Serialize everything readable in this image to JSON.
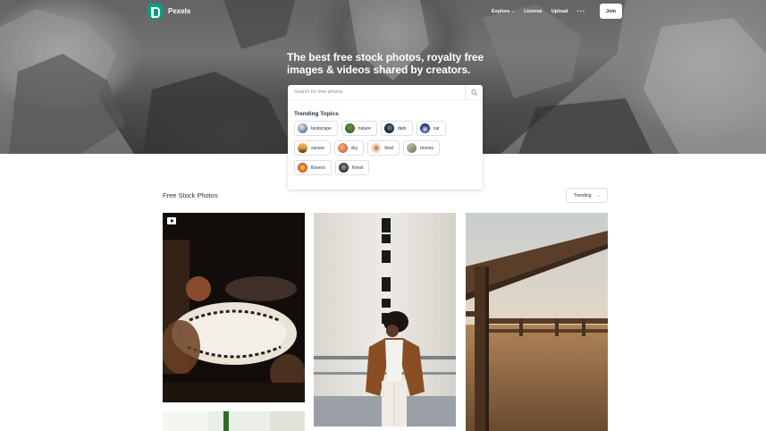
{
  "nav": {
    "logo_text": "Pexels",
    "links": [
      {
        "label": "Explore",
        "has_dropdown": true
      },
      {
        "label": "License"
      },
      {
        "label": "Upload"
      }
    ],
    "more_label": "···",
    "join_label": "Join"
  },
  "hero": {
    "headline_line1": "The best free stock photos, royalty free",
    "headline_line2": "images & videos shared by creators."
  },
  "search": {
    "placeholder": "Search for free photos",
    "trending_title": "Trending Topics",
    "topics": [
      {
        "label": "landscape",
        "color": "#6f8fb6"
      },
      {
        "label": "nature",
        "color": "#3d6b2a"
      },
      {
        "label": "dark",
        "color": "#1f2b38"
      },
      {
        "label": "car",
        "color": "#2e4a8a"
      },
      {
        "label": "sunset",
        "color": "#e09a3a"
      },
      {
        "label": "sky",
        "color": "#d8804f"
      },
      {
        "label": "food",
        "color": "#e8d8c2"
      },
      {
        "label": "money",
        "color": "#9ea08c"
      },
      {
        "label": "flowers",
        "color": "#e0702e"
      },
      {
        "label": "forest",
        "color": "#3c3a35"
      }
    ]
  },
  "main": {
    "section_title": "Free Stock Photos",
    "sort_label": "Trending"
  },
  "colors": {
    "brand": "#07a081",
    "text": "#2c343e"
  }
}
